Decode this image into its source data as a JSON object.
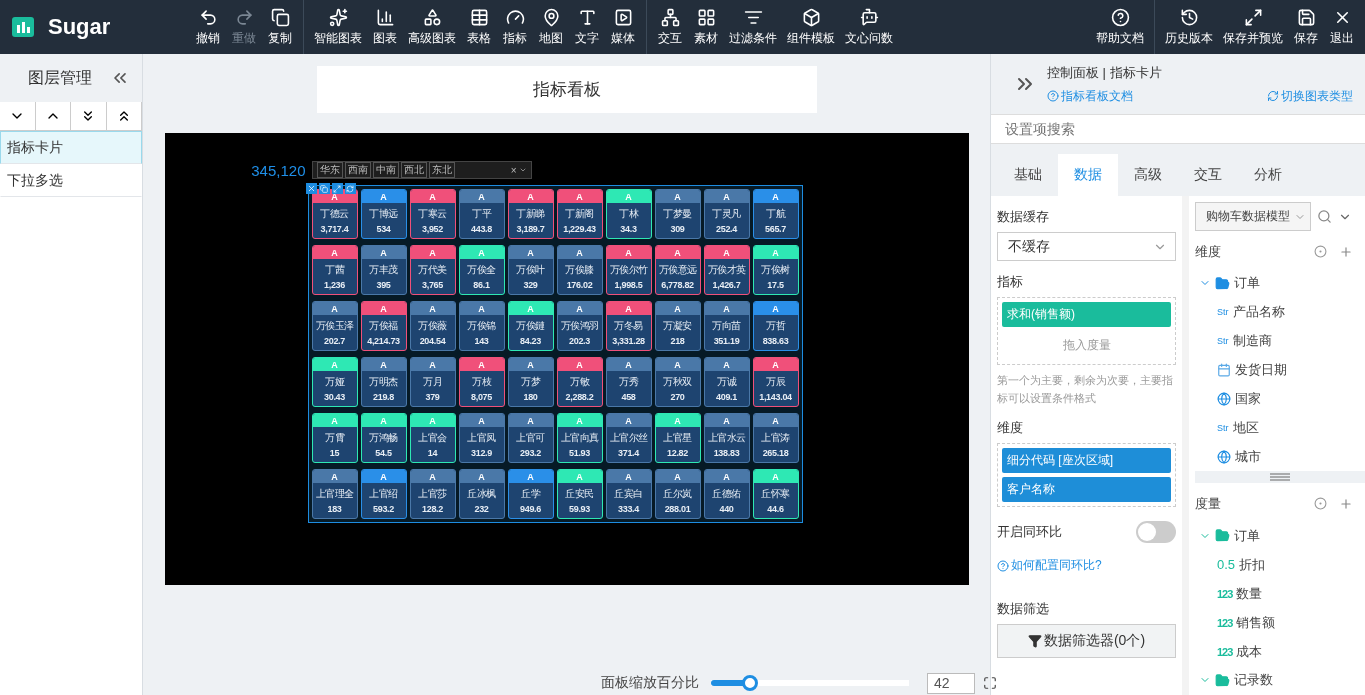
{
  "app": {
    "name": "Sugar"
  },
  "toolbar": {
    "groups": [
      {
        "items": [
          {
            "label": "撤销",
            "disabled": false
          },
          {
            "label": "重做",
            "disabled": true
          },
          {
            "label": "复制",
            "disabled": false
          }
        ]
      },
      {
        "items": [
          {
            "label": "智能图表",
            "disabled": false
          },
          {
            "label": "图表",
            "disabled": false
          },
          {
            "label": "高级图表",
            "disabled": false
          },
          {
            "label": "表格",
            "disabled": false
          },
          {
            "label": "指标",
            "disabled": false
          },
          {
            "label": "地图",
            "disabled": false
          },
          {
            "label": "文字",
            "disabled": false
          },
          {
            "label": "媒体",
            "disabled": false
          }
        ]
      },
      {
        "items": [
          {
            "label": "交互",
            "disabled": false
          },
          {
            "label": "素材",
            "disabled": false
          },
          {
            "label": "过滤条件",
            "disabled": false
          },
          {
            "label": "组件模板",
            "disabled": false
          },
          {
            "label": "文心问数",
            "disabled": false
          }
        ]
      },
      {
        "items": [
          {
            "label": "帮助文档",
            "disabled": false
          }
        ]
      },
      {
        "items": [
          {
            "label": "历史版本",
            "disabled": false
          },
          {
            "label": "保存并预览",
            "disabled": false
          },
          {
            "label": "保存",
            "disabled": false
          },
          {
            "label": "退出",
            "disabled": false
          }
        ]
      }
    ]
  },
  "layers": {
    "title": "图层管理",
    "items": [
      {
        "label": "指标卡片",
        "selected": true
      },
      {
        "label": "下拉多选",
        "selected": false
      }
    ]
  },
  "board": {
    "title": "指标看板",
    "total": "345,120",
    "filter": {
      "tags": [
        "华东",
        "西南",
        "中南",
        "西北",
        "东北"
      ],
      "clear": "×"
    },
    "cards": [
      {
        "header": "A",
        "name": "丁德云",
        "value": "3,717.4",
        "color": "#f0507a"
      },
      {
        "header": "A",
        "name": "丁博远",
        "value": "534",
        "color": "#2a8fe8"
      },
      {
        "header": "A",
        "name": "丁寒云",
        "value": "3,952",
        "color": "#f0507a"
      },
      {
        "header": "A",
        "name": "丁平",
        "value": "443.8",
        "color": "#4a78a8"
      },
      {
        "header": "A",
        "name": "丁新睇",
        "value": "3,189.7",
        "color": "#f0507a"
      },
      {
        "header": "A",
        "name": "丁新阁",
        "value": "1,229.43",
        "color": "#f0507a"
      },
      {
        "header": "A",
        "name": "丁林",
        "value": "34.3",
        "color": "#2ee8b4"
      },
      {
        "header": "A",
        "name": "丁梦曼",
        "value": "309",
        "color": "#4a78a8"
      },
      {
        "header": "A",
        "name": "丁灵凡",
        "value": "252.4",
        "color": "#4a78a8"
      },
      {
        "header": "A",
        "name": "丁航",
        "value": "565.7",
        "color": "#2a8fe8"
      },
      {
        "header": "A",
        "name": "丁茜",
        "value": "1,236",
        "color": "#f0507a"
      },
      {
        "header": "A",
        "name": "万丰茂",
        "value": "395",
        "color": "#4a78a8"
      },
      {
        "header": "A",
        "name": "万代美",
        "value": "3,765",
        "color": "#f0507a"
      },
      {
        "header": "A",
        "name": "万俟全",
        "value": "86.1",
        "color": "#2ee8b4"
      },
      {
        "header": "A",
        "name": "万俟叶",
        "value": "329",
        "color": "#4a78a8"
      },
      {
        "header": "A",
        "name": "万俟膝",
        "value": "176.02",
        "color": "#4a78a8"
      },
      {
        "header": "A",
        "name": "万俟尔竹",
        "value": "1,998.5",
        "color": "#f0507a"
      },
      {
        "header": "A",
        "name": "万俟意远",
        "value": "6,778.82",
        "color": "#f0507a"
      },
      {
        "header": "A",
        "name": "万俟才英",
        "value": "1,426.7",
        "color": "#f0507a"
      },
      {
        "header": "A",
        "name": "万俟树",
        "value": "17.5",
        "color": "#2ee8b4"
      },
      {
        "header": "A",
        "name": "万俟玉泽",
        "value": "202.7",
        "color": "#4a78a8"
      },
      {
        "header": "A",
        "name": "万俟福",
        "value": "4,214.73",
        "color": "#f0507a"
      },
      {
        "header": "A",
        "name": "万俟薇",
        "value": "204.54",
        "color": "#4a78a8"
      },
      {
        "header": "A",
        "name": "万俟锦",
        "value": "143",
        "color": "#4a78a8"
      },
      {
        "header": "A",
        "name": "万俟鏈",
        "value": "84.23",
        "color": "#2ee8b4"
      },
      {
        "header": "A",
        "name": "万俟鸿羽",
        "value": "202.3",
        "color": "#4a78a8"
      },
      {
        "header": "A",
        "name": "万冬易",
        "value": "3,331.28",
        "color": "#f0507a"
      },
      {
        "header": "A",
        "name": "万凝安",
        "value": "218",
        "color": "#4a78a8"
      },
      {
        "header": "A",
        "name": "万向苗",
        "value": "351.19",
        "color": "#4a78a8"
      },
      {
        "header": "A",
        "name": "万哲",
        "value": "838.63",
        "color": "#2a8fe8"
      },
      {
        "header": "A",
        "name": "万娅",
        "value": "30.43",
        "color": "#2ee8b4"
      },
      {
        "header": "A",
        "name": "万明杰",
        "value": "219.8",
        "color": "#4a78a8"
      },
      {
        "header": "A",
        "name": "万月",
        "value": "379",
        "color": "#4a78a8"
      },
      {
        "header": "A",
        "name": "万枝",
        "value": "8,075",
        "color": "#f0507a"
      },
      {
        "header": "A",
        "name": "万梦",
        "value": "180",
        "color": "#4a78a8"
      },
      {
        "header": "A",
        "name": "万敏",
        "value": "2,288.2",
        "color": "#f0507a"
      },
      {
        "header": "A",
        "name": "万秀",
        "value": "458",
        "color": "#4a78a8"
      },
      {
        "header": "A",
        "name": "万秋双",
        "value": "270",
        "color": "#4a78a8"
      },
      {
        "header": "A",
        "name": "万诚",
        "value": "409.1",
        "color": "#4a78a8"
      },
      {
        "header": "A",
        "name": "万辰",
        "value": "1,143.04",
        "color": "#f0507a"
      },
      {
        "header": "A",
        "name": "万霄",
        "value": "15",
        "color": "#2ee8b4"
      },
      {
        "header": "A",
        "name": "万鸿畅",
        "value": "54.5",
        "color": "#2ee8b4"
      },
      {
        "header": "A",
        "name": "上官会",
        "value": "14",
        "color": "#2ee8b4"
      },
      {
        "header": "A",
        "name": "上官凤",
        "value": "312.9",
        "color": "#4a78a8"
      },
      {
        "header": "A",
        "name": "上官可",
        "value": "293.2",
        "color": "#4a78a8"
      },
      {
        "header": "A",
        "name": "上官向真",
        "value": "51.93",
        "color": "#2ee8b4"
      },
      {
        "header": "A",
        "name": "上官尔丝",
        "value": "371.4",
        "color": "#4a78a8"
      },
      {
        "header": "A",
        "name": "上官星",
        "value": "12.82",
        "color": "#2ee8b4"
      },
      {
        "header": "A",
        "name": "上官水云",
        "value": "138.83",
        "color": "#4a78a8"
      },
      {
        "header": "A",
        "name": "上官涛",
        "value": "265.18",
        "color": "#4a78a8"
      },
      {
        "header": "A",
        "name": "上官理全",
        "value": "183",
        "color": "#4a78a8"
      },
      {
        "header": "A",
        "name": "上官绍",
        "value": "593.2",
        "color": "#2a8fe8"
      },
      {
        "header": "A",
        "name": "上官莎",
        "value": "128.2",
        "color": "#4a78a8"
      },
      {
        "header": "A",
        "name": "丘冰枫",
        "value": "232",
        "color": "#4a78a8"
      },
      {
        "header": "A",
        "name": "丘学",
        "value": "949.6",
        "color": "#2a8fe8"
      },
      {
        "header": "A",
        "name": "丘安民",
        "value": "59.93",
        "color": "#2ee8b4"
      },
      {
        "header": "A",
        "name": "丘宾白",
        "value": "333.4",
        "color": "#4a78a8"
      },
      {
        "header": "A",
        "name": "丘尔岚",
        "value": "288.01",
        "color": "#4a78a8"
      },
      {
        "header": "A",
        "name": "丘德佑",
        "value": "440",
        "color": "#4a78a8"
      },
      {
        "header": "A",
        "name": "丘怀寒",
        "value": "44.6",
        "color": "#2ee8b4"
      }
    ]
  },
  "zoom": {
    "label": "面板缩放百分比",
    "level": 0.19,
    "value": "42"
  },
  "panel": {
    "title": "控制面板 | 指标卡片",
    "doc_link": "指标看板文档",
    "switch_link": "切换图表类型",
    "search": {
      "placeholder": "设置项搜索"
    },
    "tabs": [
      {
        "label": "基础",
        "selected": false
      },
      {
        "label": "数据",
        "selected": true
      },
      {
        "label": "高级",
        "selected": false
      },
      {
        "label": "交互",
        "selected": false
      },
      {
        "label": "分析",
        "selected": false
      }
    ],
    "cache": {
      "label": "数据缓存",
      "value": "不缓存"
    },
    "metrics": {
      "label": "指标",
      "chips": [
        "求和(销售额)"
      ],
      "drop_hint": "拖入度量",
      "note": "第一个为主要，剩余为次要，主要指标可以设置条件格式"
    },
    "dimensions": {
      "label": "维度",
      "chips": [
        "细分代码 [座次区域]",
        "客户名称"
      ]
    },
    "compare": {
      "label": "开启同环比",
      "on": false,
      "help": "如何配置同环比?"
    },
    "filter": {
      "label": "数据筛选",
      "button": "数据筛选器(0个)"
    },
    "model": {
      "value": "购物车数据模型"
    },
    "dimension_tree": {
      "title": "维度",
      "items": [
        {
          "label": "订单",
          "expanded": true,
          "children": [
            {
              "kind": "text",
              "tag": "Str",
              "label": "产品名称"
            },
            {
              "kind": "text",
              "tag": "Str",
              "label": "制造商"
            },
            {
              "kind": "date",
              "label": "发货日期"
            },
            {
              "kind": "geo",
              "label": "国家"
            },
            {
              "kind": "text",
              "tag": "Str",
              "label": "地区"
            },
            {
              "kind": "geo",
              "label": "城市"
            }
          ]
        }
      ]
    },
    "measure_tree": {
      "title": "度量",
      "items": [
        {
          "label": "订单",
          "expanded": true,
          "children": [
            {
              "kind": "decimal",
              "tag": "0.5",
              "label": "折扣"
            },
            {
              "kind": "number",
              "tag": "123",
              "label": "数量"
            },
            {
              "kind": "number",
              "tag": "123",
              "label": "销售额"
            },
            {
              "kind": "number",
              "tag": "123",
              "label": "成本"
            }
          ]
        },
        {
          "label": "记录数",
          "expanded": true
        }
      ]
    }
  }
}
